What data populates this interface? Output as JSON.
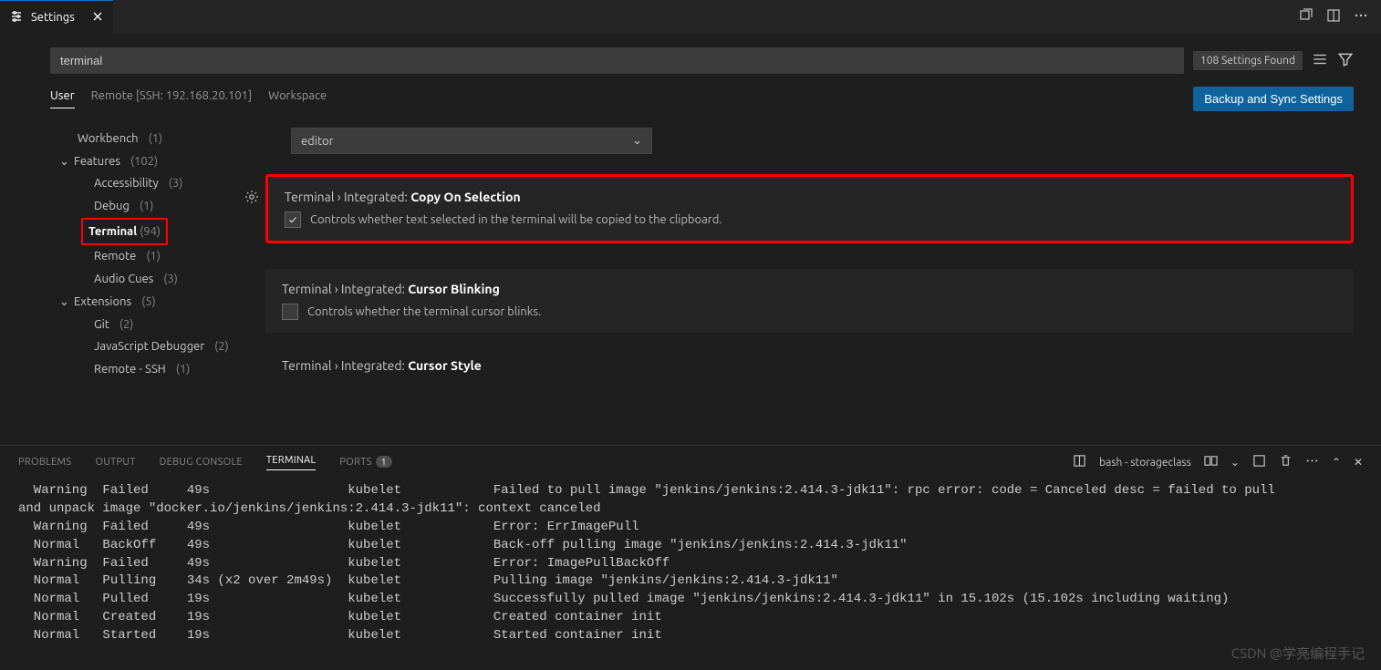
{
  "tab": {
    "title": "Settings"
  },
  "search": {
    "value": "terminal",
    "found": "108 Settings Found"
  },
  "scopes": {
    "user": "User",
    "remote": "Remote [SSH: 192.168.20.101]",
    "workspace": "Workspace"
  },
  "syncButton": "Backup and Sync Settings",
  "tree": {
    "workbench": "Workbench",
    "workbench_c": "(1)",
    "features": "Features",
    "features_c": "(102)",
    "accessibility": "Accessibility",
    "accessibility_c": "(3)",
    "debug": "Debug",
    "debug_c": "(1)",
    "terminal": "Terminal",
    "terminal_c": "(94)",
    "remote": "Remote",
    "remote_c": "(1)",
    "audio": "Audio Cues",
    "audio_c": "(3)",
    "extensions": "Extensions",
    "extensions_c": "(5)",
    "git": "Git",
    "git_c": "(2)",
    "jsdbg": "JavaScript Debugger",
    "jsdbg_c": "(2)",
    "remotessh": "Remote - SSH",
    "remotessh_c": "(1)"
  },
  "dropdown": {
    "value": "editor"
  },
  "settings": {
    "s1_cat": "Terminal › Integrated: ",
    "s1_name": "Copy On Selection",
    "s1_desc": "Controls whether text selected in the terminal will be copied to the clipboard.",
    "s2_cat": "Terminal › Integrated: ",
    "s2_name": "Cursor Blinking",
    "s2_desc": "Controls whether the terminal cursor blinks.",
    "s3_cat": "Terminal › Integrated: ",
    "s3_name": "Cursor Style"
  },
  "panelTabs": {
    "problems": "PROBLEMS",
    "output": "OUTPUT",
    "debug": "DEBUG CONSOLE",
    "terminal": "TERMINAL",
    "ports": "PORTS",
    "ports_badge": "1"
  },
  "panelRight": {
    "shell": "bash - storageclass"
  },
  "terminalLines": [
    "  Warning  Failed     49s                  kubelet            Failed to pull image \"jenkins/jenkins:2.414.3-jdk11\": rpc error: code = Canceled desc = failed to pull",
    "and unpack image \"docker.io/jenkins/jenkins:2.414.3-jdk11\": context canceled",
    "  Warning  Failed     49s                  kubelet            Error: ErrImagePull",
    "  Normal   BackOff    49s                  kubelet            Back-off pulling image \"jenkins/jenkins:2.414.3-jdk11\"",
    "  Warning  Failed     49s                  kubelet            Error: ImagePullBackOff",
    "  Normal   Pulling    34s (x2 over 2m49s)  kubelet            Pulling image \"jenkins/jenkins:2.414.3-jdk11\"",
    "  Normal   Pulled     19s                  kubelet            Successfully pulled image \"jenkins/jenkins:2.414.3-jdk11\" in 15.102s (15.102s including waiting)",
    "  Normal   Created    19s                  kubelet            Created container init",
    "  Normal   Started    19s                  kubelet            Started container init"
  ],
  "watermark": "CSDN @学亮编程手记"
}
